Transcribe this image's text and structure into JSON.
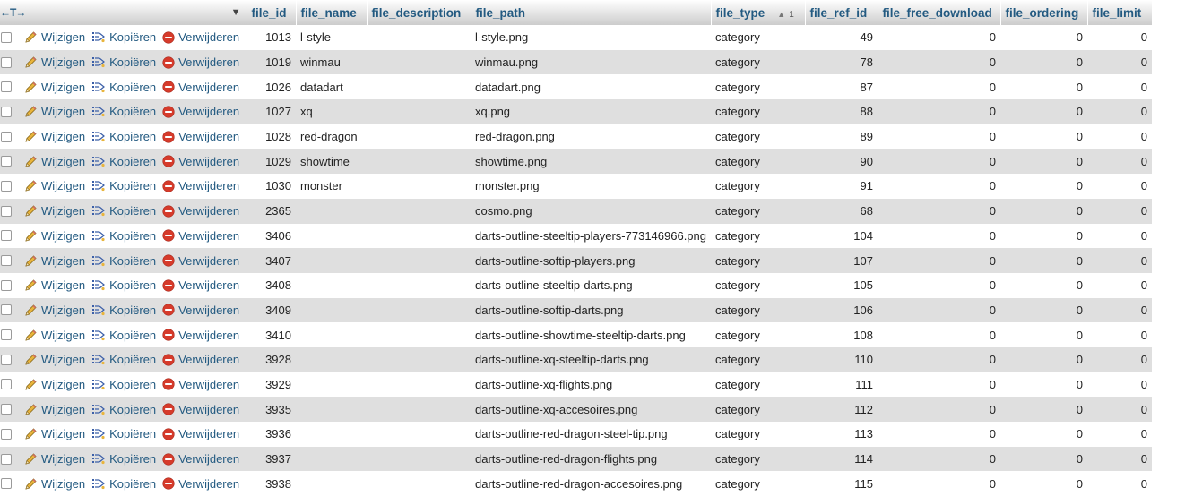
{
  "header": {
    "select_arrows": "←T→",
    "columns": [
      "file_id",
      "file_name",
      "file_description",
      "file_path",
      "file_type",
      "file_ref_id",
      "file_free_download",
      "file_ordering",
      "file_limit"
    ],
    "sort_column": "file_type",
    "sort_order": "1"
  },
  "actions": {
    "edit": "Wijzigen",
    "copy": "Kopiëren",
    "delete": "Verwijderen"
  },
  "rows": [
    {
      "file_id": "1013",
      "file_name": "l-style",
      "file_description": "",
      "file_path": "l-style.png",
      "file_type": "category",
      "file_ref_id": "49",
      "file_free_download": "0",
      "file_ordering": "0",
      "file_limit": "0"
    },
    {
      "file_id": "1019",
      "file_name": "winmau",
      "file_description": "",
      "file_path": "winmau.png",
      "file_type": "category",
      "file_ref_id": "78",
      "file_free_download": "0",
      "file_ordering": "0",
      "file_limit": "0"
    },
    {
      "file_id": "1026",
      "file_name": "datadart",
      "file_description": "",
      "file_path": "datadart.png",
      "file_type": "category",
      "file_ref_id": "87",
      "file_free_download": "0",
      "file_ordering": "0",
      "file_limit": "0"
    },
    {
      "file_id": "1027",
      "file_name": "xq",
      "file_description": "",
      "file_path": "xq.png",
      "file_type": "category",
      "file_ref_id": "88",
      "file_free_download": "0",
      "file_ordering": "0",
      "file_limit": "0"
    },
    {
      "file_id": "1028",
      "file_name": "red-dragon",
      "file_description": "",
      "file_path": "red-dragon.png",
      "file_type": "category",
      "file_ref_id": "89",
      "file_free_download": "0",
      "file_ordering": "0",
      "file_limit": "0"
    },
    {
      "file_id": "1029",
      "file_name": "showtime",
      "file_description": "",
      "file_path": "showtime.png",
      "file_type": "category",
      "file_ref_id": "90",
      "file_free_download": "0",
      "file_ordering": "0",
      "file_limit": "0"
    },
    {
      "file_id": "1030",
      "file_name": "monster",
      "file_description": "",
      "file_path": "monster.png",
      "file_type": "category",
      "file_ref_id": "91",
      "file_free_download": "0",
      "file_ordering": "0",
      "file_limit": "0"
    },
    {
      "file_id": "2365",
      "file_name": "",
      "file_description": "",
      "file_path": "cosmo.png",
      "file_type": "category",
      "file_ref_id": "68",
      "file_free_download": "0",
      "file_ordering": "0",
      "file_limit": "0"
    },
    {
      "file_id": "3406",
      "file_name": "",
      "file_description": "",
      "file_path": "darts-outline-steeltip-players-773146966.png",
      "file_type": "category",
      "file_ref_id": "104",
      "file_free_download": "0",
      "file_ordering": "0",
      "file_limit": "0"
    },
    {
      "file_id": "3407",
      "file_name": "",
      "file_description": "",
      "file_path": "darts-outline-softip-players.png",
      "file_type": "category",
      "file_ref_id": "107",
      "file_free_download": "0",
      "file_ordering": "0",
      "file_limit": "0"
    },
    {
      "file_id": "3408",
      "file_name": "",
      "file_description": "",
      "file_path": "darts-outline-steeltip-darts.png",
      "file_type": "category",
      "file_ref_id": "105",
      "file_free_download": "0",
      "file_ordering": "0",
      "file_limit": "0"
    },
    {
      "file_id": "3409",
      "file_name": "",
      "file_description": "",
      "file_path": "darts-outline-softip-darts.png",
      "file_type": "category",
      "file_ref_id": "106",
      "file_free_download": "0",
      "file_ordering": "0",
      "file_limit": "0"
    },
    {
      "file_id": "3410",
      "file_name": "",
      "file_description": "",
      "file_path": "darts-outline-showtime-steeltip-darts.png",
      "file_type": "category",
      "file_ref_id": "108",
      "file_free_download": "0",
      "file_ordering": "0",
      "file_limit": "0"
    },
    {
      "file_id": "3928",
      "file_name": "",
      "file_description": "",
      "file_path": "darts-outline-xq-steeltip-darts.png",
      "file_type": "category",
      "file_ref_id": "110",
      "file_free_download": "0",
      "file_ordering": "0",
      "file_limit": "0"
    },
    {
      "file_id": "3929",
      "file_name": "",
      "file_description": "",
      "file_path": "darts-outline-xq-flights.png",
      "file_type": "category",
      "file_ref_id": "111",
      "file_free_download": "0",
      "file_ordering": "0",
      "file_limit": "0"
    },
    {
      "file_id": "3935",
      "file_name": "",
      "file_description": "",
      "file_path": "darts-outline-xq-accesoires.png",
      "file_type": "category",
      "file_ref_id": "112",
      "file_free_download": "0",
      "file_ordering": "0",
      "file_limit": "0"
    },
    {
      "file_id": "3936",
      "file_name": "",
      "file_description": "",
      "file_path": "darts-outline-red-dragon-steel-tip.png",
      "file_type": "category",
      "file_ref_id": "113",
      "file_free_download": "0",
      "file_ordering": "0",
      "file_limit": "0"
    },
    {
      "file_id": "3937",
      "file_name": "",
      "file_description": "",
      "file_path": "darts-outline-red-dragon-flights.png",
      "file_type": "category",
      "file_ref_id": "114",
      "file_free_download": "0",
      "file_ordering": "0",
      "file_limit": "0"
    },
    {
      "file_id": "3938",
      "file_name": "",
      "file_description": "",
      "file_path": "darts-outline-red-dragon-accesoires.png",
      "file_type": "category",
      "file_ref_id": "115",
      "file_free_download": "0",
      "file_ordering": "0",
      "file_limit": "0"
    }
  ],
  "colors": {
    "link": "#235a81",
    "row_even": "#dfdfdf",
    "row_odd": "#ffffff",
    "delete_red": "#d63b2b",
    "pencil": "#e8b43c"
  },
  "icons": {
    "edit": "pencil-icon",
    "copy": "copy-icon",
    "delete": "delete-icon",
    "sort": "sort-ascending-icon",
    "menu": "chevron-down-icon"
  }
}
